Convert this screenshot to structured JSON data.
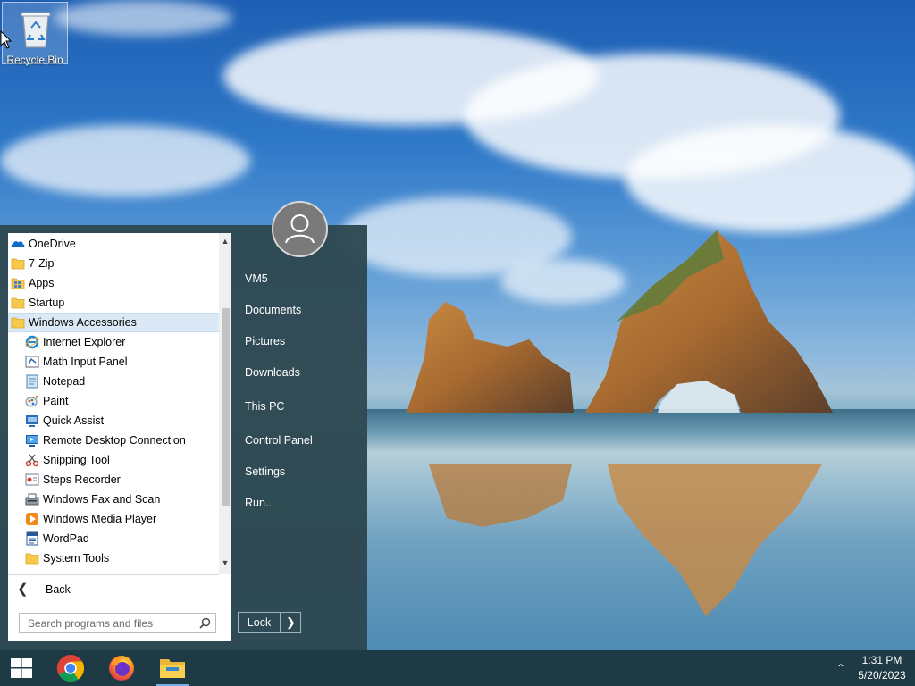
{
  "desktop": {
    "icons": [
      {
        "label": "Recycle Bin"
      }
    ]
  },
  "start_menu": {
    "programs": [
      {
        "label": "OneDrive",
        "icon": "onedrive-icon",
        "level": 0
      },
      {
        "label": "7-Zip",
        "icon": "folder-icon",
        "level": 0
      },
      {
        "label": "Apps",
        "icon": "apps-icon",
        "level": 0
      },
      {
        "label": "Startup",
        "icon": "folder-icon",
        "level": 0
      },
      {
        "label": "Windows Accessories",
        "icon": "folder-icon",
        "level": 0,
        "selected": true
      },
      {
        "label": "Internet Explorer",
        "icon": "internet-explorer-icon",
        "level": 1
      },
      {
        "label": "Math Input Panel",
        "icon": "math-input-panel-icon",
        "level": 1
      },
      {
        "label": "Notepad",
        "icon": "notepad-icon",
        "level": 1
      },
      {
        "label": "Paint",
        "icon": "paint-icon",
        "level": 1
      },
      {
        "label": "Quick Assist",
        "icon": "quick-assist-icon",
        "level": 1
      },
      {
        "label": "Remote Desktop Connection",
        "icon": "remote-desktop-icon",
        "level": 1
      },
      {
        "label": "Snipping Tool",
        "icon": "snipping-tool-icon",
        "level": 1
      },
      {
        "label": "Steps Recorder",
        "icon": "steps-recorder-icon",
        "level": 1
      },
      {
        "label": "Windows Fax and Scan",
        "icon": "fax-scan-icon",
        "level": 1
      },
      {
        "label": "Windows Media Player",
        "icon": "media-player-icon",
        "level": 1
      },
      {
        "label": "WordPad",
        "icon": "wordpad-icon",
        "level": 1
      },
      {
        "label": "System Tools",
        "icon": "folder-icon",
        "level": 1
      }
    ],
    "back_label": "Back",
    "search": {
      "placeholder": "Search programs and files"
    },
    "user": {
      "name": "VM5"
    },
    "places": [
      {
        "label": "VM5"
      },
      {
        "label": "Documents"
      },
      {
        "label": "Pictures"
      },
      {
        "label": "Downloads"
      },
      {
        "label": "This PC"
      },
      {
        "label": "Control Panel"
      },
      {
        "label": "Settings"
      },
      {
        "label": "Run..."
      }
    ],
    "power": {
      "label": "Lock"
    }
  },
  "taskbar": {
    "pinned": [
      {
        "name": "Google Chrome",
        "icon": "chrome-icon"
      },
      {
        "name": "Firefox",
        "icon": "firefox-icon"
      },
      {
        "name": "File Explorer",
        "icon": "file-explorer-icon"
      }
    ],
    "clock": {
      "time": "1:31 PM",
      "date": "5/20/2023"
    }
  },
  "colors": {
    "start_menu_bg": "#2e4850",
    "taskbar_bg": "#1e3a44",
    "selection": "#dbe9f7"
  }
}
